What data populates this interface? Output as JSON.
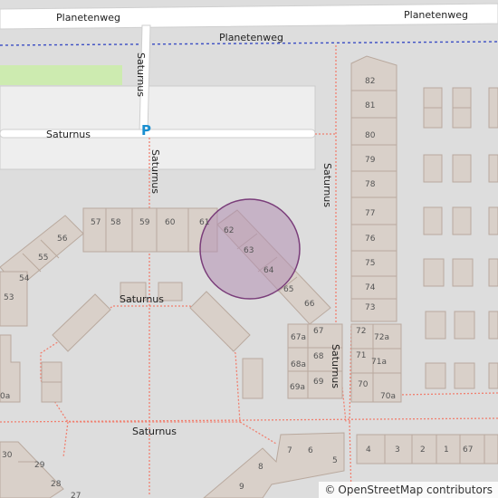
{
  "map": {
    "roads": {
      "planetenweg_left": "Planetenweg",
      "planetenweg_right": "Planetenweg",
      "planetenweg_path": "Planetenweg",
      "saturnus_vertical_top": "Saturnus",
      "saturnus_horizontal": "Saturnus",
      "saturnus_footpath": "Saturnus",
      "saturnus_right": "Saturnus",
      "saturnus_square": "Saturnus",
      "saturnus_bottom": "Saturnus",
      "saturnus_lower_right": "Saturnus"
    },
    "parking_symbol": "P",
    "house_numbers": {
      "n82": "82",
      "n81": "81",
      "n80": "80",
      "n79": "79",
      "n78": "78",
      "n77": "77",
      "n76": "76",
      "n75": "75",
      "n74": "74",
      "n73": "73",
      "n72": "72",
      "n72a": "72a",
      "n71": "71",
      "n71a": "71a",
      "n70": "70",
      "n70a": "70a",
      "n57": "57",
      "n58": "58",
      "n59": "59",
      "n60": "60",
      "n61": "61",
      "n62": "62",
      "n63": "63",
      "n64": "64",
      "n65": "65",
      "n66": "66",
      "n67": "67",
      "n67a": "67a",
      "n68": "68",
      "n68a": "68a",
      "n69": "69",
      "n69a": "69a",
      "n56": "56",
      "n55": "55",
      "n54": "54",
      "n53": "53",
      "n70a_left": "0a",
      "n30": "30",
      "n29": "29",
      "n28": "28",
      "n27": "27",
      "n9": "9",
      "n8": "8",
      "n7": "7",
      "n6": "6",
      "n5": "5",
      "n4": "4",
      "n3": "3",
      "n2": "2",
      "n1": "1",
      "n67b": "67"
    },
    "highlight_color": "#b38fb3"
  },
  "attribution": {
    "symbol": "©",
    "text": "OpenStreetMap contributors"
  }
}
